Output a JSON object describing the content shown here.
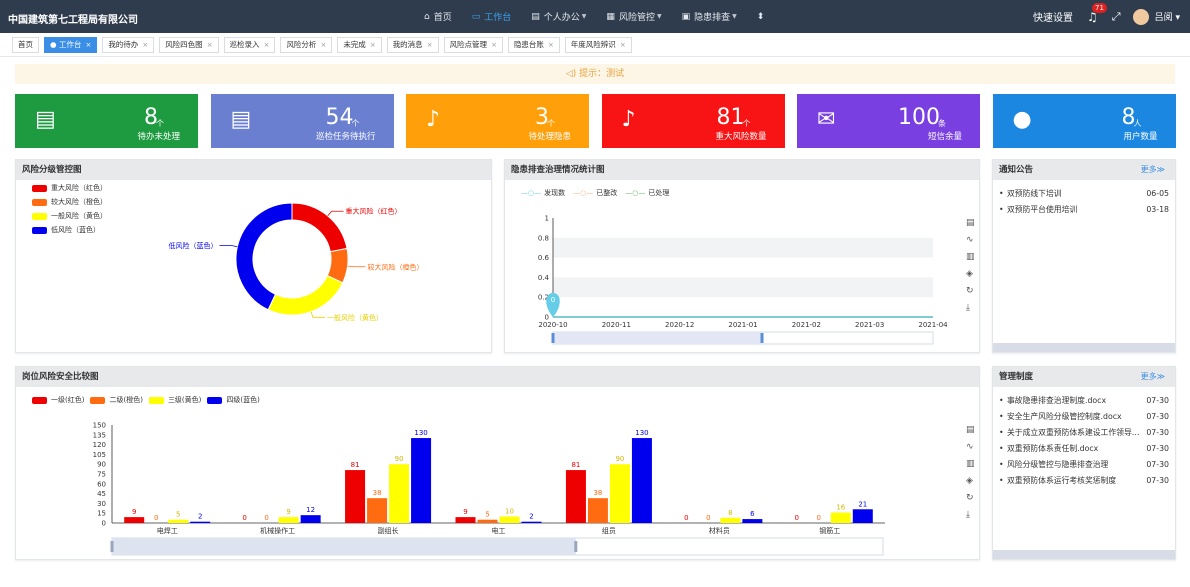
{
  "header": {
    "brand": "中国建筑第七工程局有限公司",
    "nav": [
      {
        "label": "首页",
        "icon": "dashboard-icon",
        "glyph": "⌂",
        "active": false,
        "caret": false
      },
      {
        "label": "工作台",
        "icon": "monitor-icon",
        "glyph": "▭",
        "active": true,
        "caret": false
      },
      {
        "label": "个人办公",
        "icon": "desk-icon",
        "glyph": "▤",
        "active": false,
        "caret": true
      },
      {
        "label": "风险管控",
        "icon": "grid-icon",
        "glyph": "▦",
        "active": false,
        "caret": true
      },
      {
        "label": "隐患排查",
        "icon": "doc-icon",
        "glyph": "▣",
        "active": false,
        "caret": true
      }
    ],
    "quick_settings": "快速设置",
    "notifications": "71",
    "user": "吕阅"
  },
  "tabs": [
    {
      "label": "首页",
      "active": false,
      "closable": false
    },
    {
      "label": "工作台",
      "active": true,
      "closable": true
    },
    {
      "label": "我的待办",
      "active": false,
      "closable": true
    },
    {
      "label": "风险四色图",
      "active": false,
      "closable": true
    },
    {
      "label": "巡检录入",
      "active": false,
      "closable": true
    },
    {
      "label": "风险分析",
      "active": false,
      "closable": true
    },
    {
      "label": "未完成",
      "active": false,
      "closable": true
    },
    {
      "label": "我的消息",
      "active": false,
      "closable": true
    },
    {
      "label": "风险点管理",
      "active": false,
      "closable": true
    },
    {
      "label": "隐患台账",
      "active": false,
      "closable": true
    },
    {
      "label": "年度风险辨识",
      "active": false,
      "closable": true
    }
  ],
  "notice": "提示：测试",
  "cards": [
    {
      "value": "8",
      "unit": "个",
      "label": "待办未处理",
      "color": "#1e9b40",
      "icon": "clipboard-clock-icon",
      "glyph": "▤"
    },
    {
      "value": "54",
      "unit": "个",
      "label": "巡检任务待执行",
      "color": "#6a7fd0",
      "icon": "clipboard-clock-icon",
      "glyph": "▤"
    },
    {
      "value": "3",
      "unit": "个",
      "label": "待处理隐患",
      "color": "#ff9f0a",
      "icon": "bell-icon",
      "glyph": "♪"
    },
    {
      "value": "81",
      "unit": "个",
      "label": "重大风险数量",
      "color": "#f81414",
      "icon": "bell-icon",
      "glyph": "♪"
    },
    {
      "value": "100",
      "unit": "条",
      "label": "短信余量",
      "color": "#7a3fe0",
      "icon": "mail-icon",
      "glyph": "✉"
    },
    {
      "value": "8",
      "unit": "人",
      "label": "用户数量",
      "color": "#1c87e0",
      "icon": "users-icon",
      "glyph": "●"
    }
  ],
  "risk_panel": {
    "title": "风险分级管控图",
    "legend": [
      {
        "label": "重大风险（红色）",
        "color": "#ee0000"
      },
      {
        "label": "较大风险（橙色）",
        "color": "#ff6b10"
      },
      {
        "label": "一般风险（黄色）",
        "color": "#ffff00"
      },
      {
        "label": "低风险（蓝色）",
        "color": "#0000ee"
      }
    ],
    "donut_labels": [
      "重大风险（红色）",
      "较大风险（橙色）",
      "一般风险（黄色）",
      "低风险（蓝色）"
    ]
  },
  "hazard_panel": {
    "title": "隐患排查治理情况统计图",
    "legend": [
      {
        "label": "发现数",
        "color": "#66cde8"
      },
      {
        "label": "已整改",
        "color": "#f2b28a"
      },
      {
        "label": "已处理",
        "color": "#5cb85c"
      }
    ],
    "point_label": "0"
  },
  "notice_panel": {
    "title": "通知公告",
    "more": "更多≫",
    "items": [
      {
        "title": "双预防线下培训",
        "date": "06-05"
      },
      {
        "title": "双预防平台使用培训",
        "date": "03-18"
      }
    ]
  },
  "post_panel": {
    "title": "岗位风险安全比较图"
  },
  "rules_panel": {
    "title": "管理制度",
    "more": "更多≫",
    "items": [
      {
        "title": "事故隐患排查治理制度.docx",
        "date": "07-30"
      },
      {
        "title": "安全生产风险分级管控制度.docx",
        "date": "07-30"
      },
      {
        "title": "关于成立双重预防体系建设工作领导小组",
        "date": "07-30"
      },
      {
        "title": "双重预防体系责任制.docx",
        "date": "07-30"
      },
      {
        "title": "风险分级管控与隐患排查治理",
        "date": "07-30"
      },
      {
        "title": "双重预防体系运行考核奖惩制度",
        "date": "07-30"
      }
    ]
  },
  "chart_data": [
    {
      "type": "pie",
      "title": "风险分级管控图",
      "donut": true,
      "slices": [
        {
          "label": "重大风险（红色）",
          "value": 22,
          "color": "#ee0000"
        },
        {
          "label": "较大风险（橙色）",
          "value": 10,
          "color": "#ff6b10"
        },
        {
          "label": "一般风险（黄色）",
          "value": 25,
          "color": "#ffff00"
        },
        {
          "label": "低风险（蓝色）",
          "value": 43,
          "color": "#0000ee"
        }
      ]
    },
    {
      "type": "line",
      "title": "隐患排查治理情况统计图",
      "x": [
        "2020-10",
        "2020-11",
        "2020-12",
        "2021-01",
        "2021-02",
        "2021-03",
        "2021-04"
      ],
      "yticks": [
        "0",
        "0.2",
        "0.4",
        "0.6",
        "0.8",
        "1"
      ],
      "ylim": [
        0,
        1
      ],
      "series": [
        {
          "name": "发现数",
          "values": [
            0,
            0,
            0,
            0,
            0,
            0,
            0
          ],
          "color": "#66cde8"
        },
        {
          "name": "已整改",
          "values": [
            0,
            0,
            0,
            0,
            0,
            0,
            0
          ],
          "color": "#f2b28a"
        },
        {
          "name": "已处理",
          "values": [
            0,
            0,
            0,
            0,
            0,
            0,
            0
          ],
          "color": "#5cb85c"
        }
      ]
    },
    {
      "type": "bar",
      "title": "岗位风险安全比较图",
      "categories": [
        "电焊工",
        "机械操作工",
        "副组长",
        "电工",
        "组员",
        "材料员",
        "钢筋工"
      ],
      "yticks": [
        "0",
        "15",
        "30",
        "45",
        "60",
        "75",
        "90",
        "105",
        "120",
        "135",
        "150"
      ],
      "ylim": [
        0,
        150
      ],
      "series": [
        {
          "name": "一级(红色)",
          "color": "#ee0000",
          "values": [
            9,
            0,
            81,
            9,
            81,
            0,
            0
          ]
        },
        {
          "name": "二级(橙色)",
          "color": "#ff6b10",
          "values": [
            0,
            0,
            38,
            5,
            38,
            0,
            0
          ]
        },
        {
          "name": "三级(黄色)",
          "color": "#ffff00",
          "values": [
            5,
            9,
            90,
            10,
            90,
            8,
            16
          ]
        },
        {
          "name": "四级(蓝色)",
          "color": "#0000ee",
          "values": [
            2,
            12,
            130,
            2,
            130,
            6,
            21
          ]
        }
      ]
    }
  ]
}
